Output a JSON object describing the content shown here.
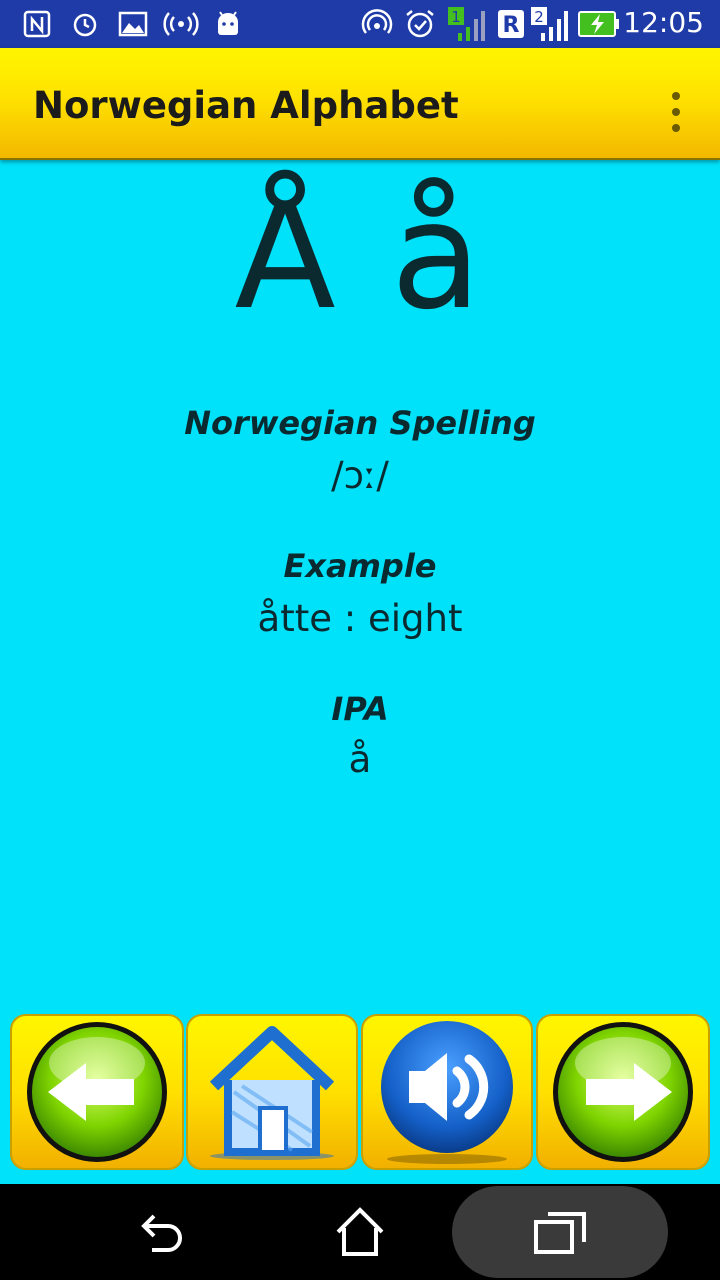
{
  "status_bar": {
    "time": "12:05",
    "icons": [
      "nfc-icon",
      "alarm-clock-icon",
      "image-icon",
      "hotspot-icon",
      "android-icon",
      "nfc-ring-icon",
      "alarm-active-icon",
      "signal-sim1-icon",
      "roaming-icon",
      "signal-sim2-icon",
      "battery-charging-icon"
    ],
    "sim1_label": "1",
    "roaming_label": "R",
    "sim2_label": "2"
  },
  "app_bar": {
    "title": "Norwegian Alphabet"
  },
  "letter": {
    "display": "Å å"
  },
  "spelling": {
    "label": "Norwegian Spelling",
    "value": "/ɔː/"
  },
  "example": {
    "label": "Example",
    "value": "åtte : eight"
  },
  "ipa": {
    "label": "IPA",
    "value": "å"
  },
  "buttons": [
    "previous-letter",
    "home",
    "play-sound",
    "next-letter"
  ],
  "colors": {
    "background": "#00e1fa",
    "status_bar": "#1f3ba8",
    "app_bar_top": "#fff600",
    "app_bar_bottom": "#f3b800"
  }
}
